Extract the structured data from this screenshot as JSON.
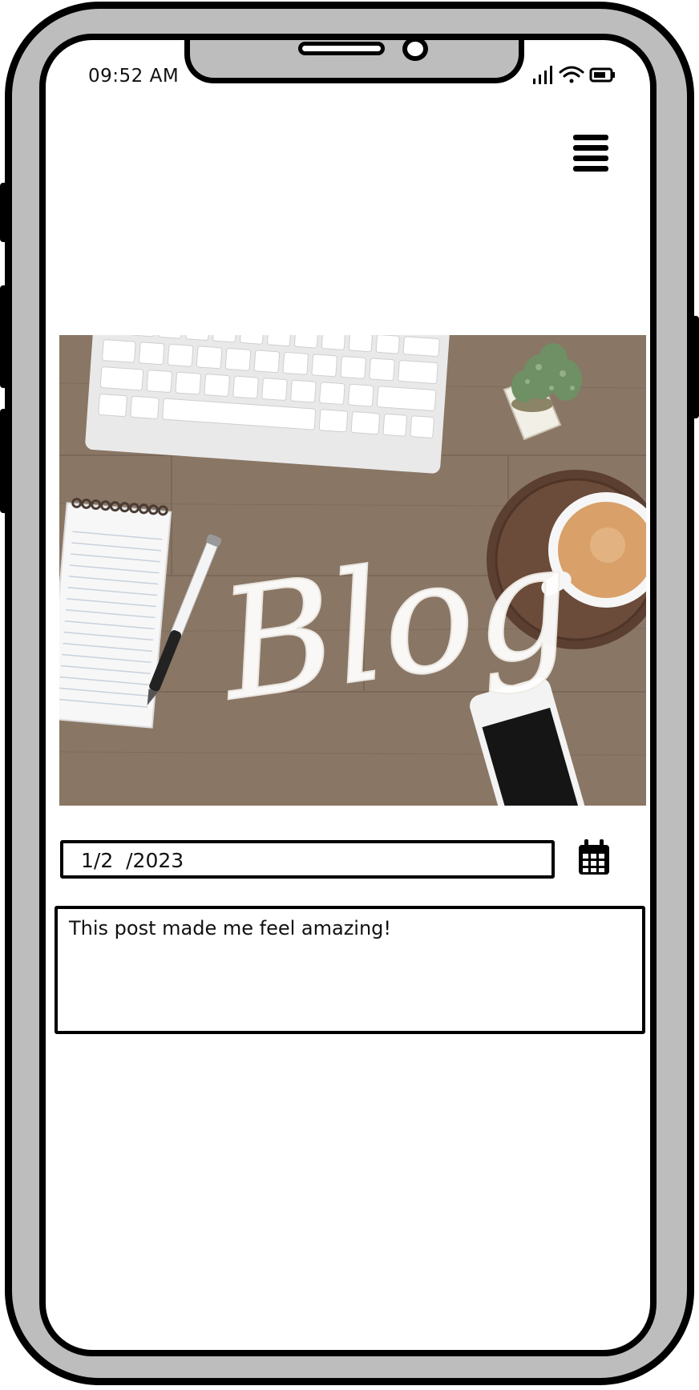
{
  "status_bar": {
    "time": "09:52 AM"
  },
  "hero_image": {
    "script_text": "Blog"
  },
  "entry": {
    "date_value": "1/2  /2023",
    "note_text": "This post made me feel amazing!"
  },
  "icons": {
    "menu": "hamburger-menu-icon",
    "calendar": "calendar-icon",
    "signal": "signal-icon",
    "wifi": "wifi-icon",
    "battery": "battery-icon"
  },
  "colors": {
    "frame": "#bdbdbd",
    "outline": "#000000",
    "screen": "#ffffff",
    "desk": "#8a7665"
  }
}
